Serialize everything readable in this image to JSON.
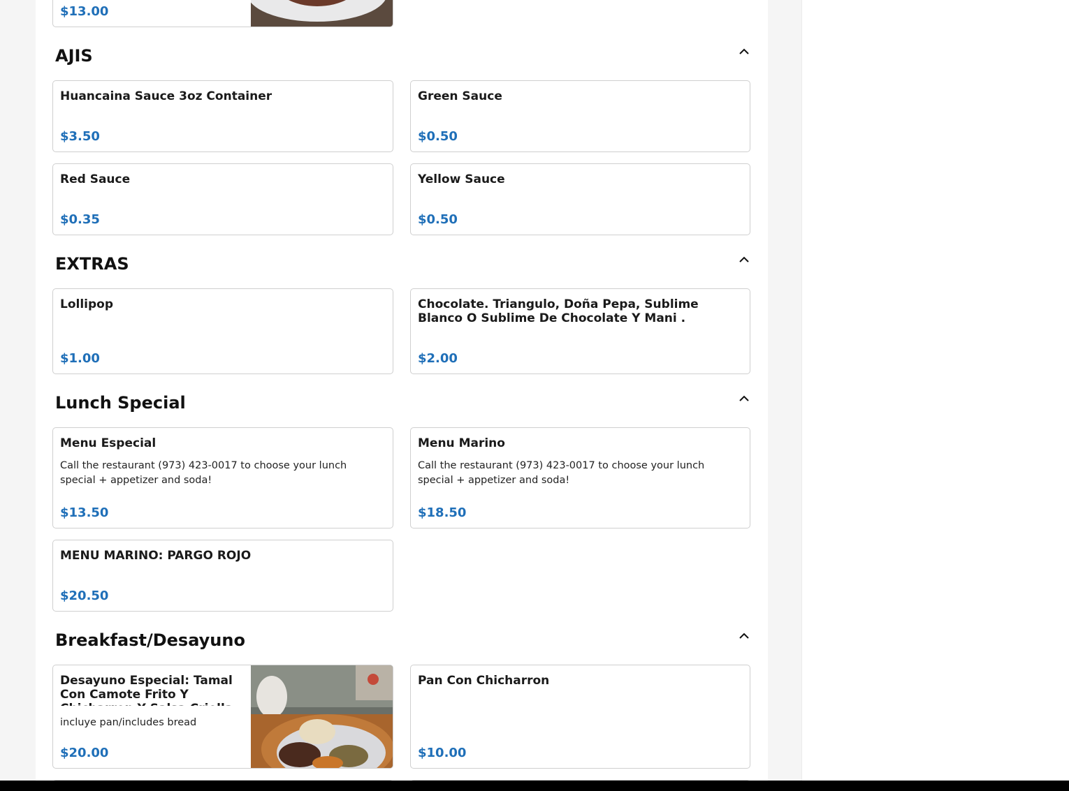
{
  "top_item": {
    "price": "$13.00"
  },
  "sections": [
    {
      "title": "AJIS",
      "items": [
        {
          "name": "Huancaina Sauce 3oz Container",
          "price": "$3.50"
        },
        {
          "name": "Green Sauce",
          "price": "$0.50"
        },
        {
          "name": "Red Sauce",
          "price": "$0.35"
        },
        {
          "name": "Yellow Sauce",
          "price": "$0.50"
        }
      ]
    },
    {
      "title": "EXTRAS",
      "items": [
        {
          "name": "Lollipop",
          "price": "$1.00"
        },
        {
          "name": "Chocolate. Triangulo, Doña Pepa, Sublime Blanco O Sublime De Chocolate Y Mani .",
          "price": "$2.00"
        }
      ]
    },
    {
      "title": "Lunch Special",
      "items": [
        {
          "name": "Menu Especial",
          "description": "Call the restaurant (973) 423-0017 to choose your lunch special + appetizer and soda!",
          "price": "$13.50"
        },
        {
          "name": "Menu Marino",
          "description": "Call the restaurant (973) 423-0017 to choose your lunch special + appetizer and soda!",
          "price": "$18.50"
        },
        {
          "name": "MENU MARINO: PARGO ROJO",
          "price": "$20.50"
        }
      ]
    },
    {
      "title": "Breakfast/Desayuno",
      "items": [
        {
          "name": "Desayuno Especial: Tamal Con Camote Frito Y Chicharron Y Salsa Criolla",
          "description": "incluye pan/includes bread",
          "price": "$20.00"
        },
        {
          "name": "Pan Con Chicharron",
          "price": "$10.00"
        }
      ]
    }
  ],
  "icons": {
    "collapse": "chevron-up-icon"
  },
  "colors": {
    "price": "#1f6fb8",
    "border": "#cfcfcf",
    "page_bg": "#f5f5f5"
  }
}
